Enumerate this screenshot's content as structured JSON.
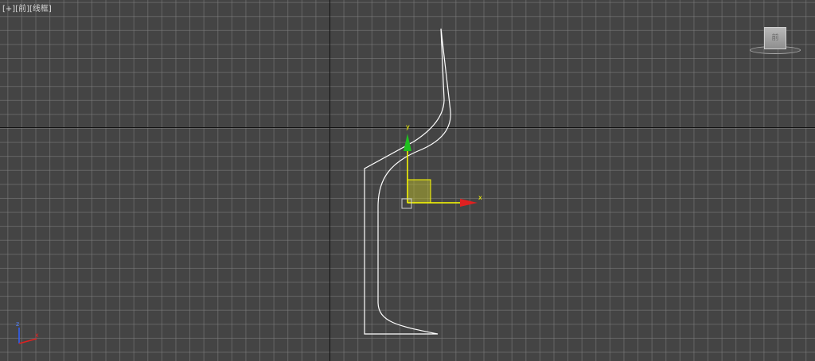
{
  "viewport": {
    "label_plus": "[+]",
    "label_view": "[前]",
    "label_shading": "[线框]"
  },
  "viewcube": {
    "face_label": "前"
  },
  "gizmo": {
    "x_label": "x",
    "y_label": "y"
  },
  "axis_tripod": {
    "z_label": "z",
    "x_label": "x"
  },
  "colors": {
    "background": "#444444",
    "grid": "#808080",
    "spline": "#ffffff",
    "x_axis": "#e02020",
    "y_axis": "#20c020",
    "selected_axis": "#ffff00"
  },
  "icons": [
    "viewcube-icon",
    "transform-gizmo-icon",
    "axis-tripod-icon"
  ]
}
